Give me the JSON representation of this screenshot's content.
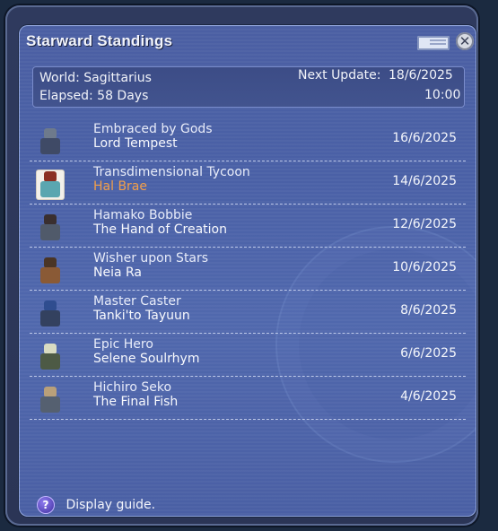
{
  "window": {
    "title": "Starward Standings"
  },
  "info": {
    "world": "World: Sagittarius",
    "elapsed": "Elapsed: 58 Days",
    "next_update_label": "Next Update:",
    "next_update_date": "18/6/2025",
    "next_update_time": "10:00"
  },
  "entries": [
    {
      "title": "Embraced by Gods",
      "name": "Lord Tempest",
      "date": "16/6/2025",
      "avatar": "knight-sprite-icon",
      "highlight": false
    },
    {
      "title": "Transdimensional Tycoon",
      "name": "Hal Brae",
      "date": "14/6/2025",
      "avatar": "player-sprite-icon",
      "highlight": true
    },
    {
      "title": "Hamako Bobbie",
      "name": "The Hand of Creation",
      "date": "12/6/2025",
      "avatar": "warrior-sprite-icon",
      "highlight": false
    },
    {
      "title": "Wisher upon Stars",
      "name": "Neia Ra",
      "date": "10/6/2025",
      "avatar": "ranger-sprite-icon",
      "highlight": false
    },
    {
      "title": "Master Caster",
      "name": "Tanki'to Tayuun",
      "date": "8/6/2025",
      "avatar": "mage-sprite-icon",
      "highlight": false
    },
    {
      "title": "Epic Hero",
      "name": "Selene Soulrhym",
      "date": "6/6/2025",
      "avatar": "hero-sprite-icon",
      "highlight": false
    },
    {
      "title": "Hichiro Seko",
      "name": "The Final Fish",
      "date": "4/6/2025",
      "avatar": "fisher-sprite-icon",
      "highlight": false
    }
  ],
  "footer": {
    "guide_icon": "?",
    "guide_label": "Display guide."
  },
  "colors": {
    "panel": "#4b5fa3",
    "highlight_name": "#f29f4a"
  }
}
